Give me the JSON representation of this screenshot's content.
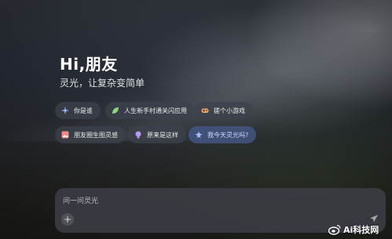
{
  "hero": {
    "title": "Hi,朋友",
    "subtitle": "灵光，让复杂变简单"
  },
  "suggestions": [
    {
      "label": "你是谁",
      "icon": "sparkle-icon",
      "active": false
    },
    {
      "label": "人生新手村通关闪应用",
      "icon": "leaf-icon",
      "active": false
    },
    {
      "label": "搓个小游戏",
      "icon": "gamepad-icon",
      "active": false
    },
    {
      "label": "朋友圈生图灵感",
      "icon": "image-icon",
      "active": false
    },
    {
      "label": "原来是这样",
      "icon": "bulb-icon",
      "active": false
    },
    {
      "label": "我今天灵光吗?",
      "icon": "magic-icon",
      "active": true
    }
  ],
  "input": {
    "placeholder": "问一问灵光",
    "add_label": "+"
  },
  "watermark": {
    "text": "Ai科技网"
  },
  "colors": {
    "chip_bg": "#3c424c",
    "chip_active": "#465a8c",
    "input_bg": "#3c3e46"
  }
}
